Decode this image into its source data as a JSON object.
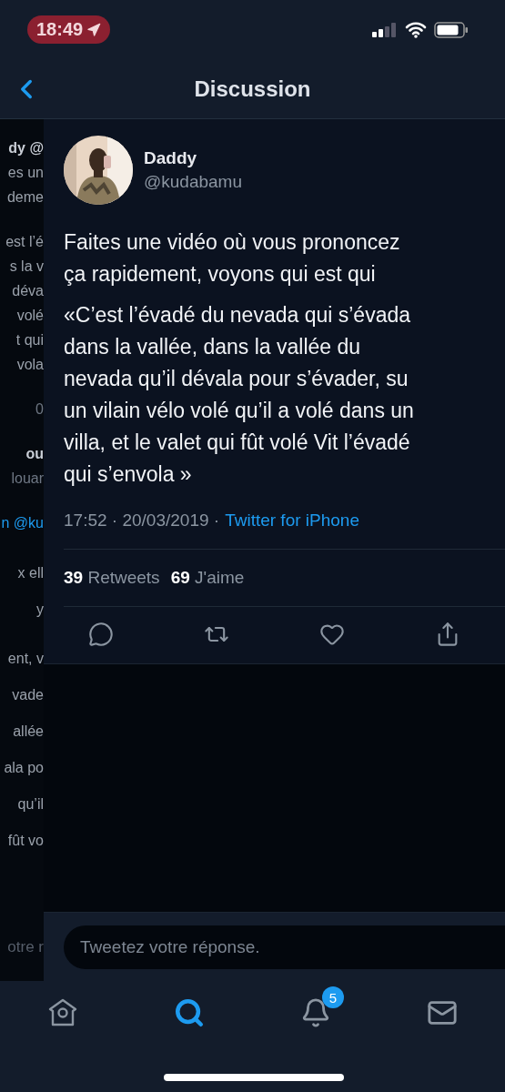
{
  "status_bar": {
    "time": "18:49"
  },
  "header": {
    "title": "Discussion"
  },
  "background_page": {
    "blocks": [
      {
        "kind": "small",
        "lines": [
          {
            "text": "dy @",
            "kind": "bold"
          },
          {
            "text": "es un",
            "kind": "text"
          },
          {
            "text": "deme",
            "kind": "text"
          }
        ]
      },
      {
        "kind": "small",
        "lines": [
          {
            "text": "est l’é",
            "kind": "text"
          },
          {
            "text": "s la v",
            "kind": "text"
          },
          {
            "text": "déva",
            "kind": "text"
          },
          {
            "text": "volé",
            "kind": "text"
          },
          {
            "text": "t qui",
            "kind": "text"
          },
          {
            "text": "vola",
            "kind": "text"
          }
        ]
      },
      {
        "kind": "small",
        "lines": [
          {
            "text": "0",
            "kind": "muted"
          }
        ]
      },
      {
        "kind": "small",
        "lines": [
          {
            "text": "ou",
            "kind": "bold"
          },
          {
            "text": "louar",
            "kind": "muted"
          }
        ]
      },
      {
        "kind": "small",
        "lines": [
          {
            "text": "n @ku",
            "kind": "link"
          }
        ]
      },
      {
        "kind": "large",
        "lines": [
          {
            "text": "x ell",
            "kind": "text"
          },
          {
            "text": "y",
            "kind": "text"
          }
        ]
      },
      {
        "kind": "large",
        "lines": [
          {
            "text": "ent, v",
            "kind": "text"
          },
          {
            "text": "vade",
            "kind": "text"
          },
          {
            "text": "allée",
            "kind": "text"
          },
          {
            "text": "ala po",
            "kind": "text"
          },
          {
            "text": "qu’il",
            "kind": "text"
          },
          {
            "text": "fût vo",
            "kind": "text"
          }
        ]
      }
    ],
    "reply_fragment": "otre r"
  },
  "tweet": {
    "author": {
      "name": "Daddy",
      "handle": "@kudabamu"
    },
    "paragraphs": [
      [
        "Faites une vidéo où vous prononcez",
        "ça rapidement, voyons qui est qui"
      ],
      [
        "«C’est l’évadé du nevada qui s’évada",
        "dans la vallée, dans la vallée du",
        "nevada qu’il dévala pour s’évader, su",
        "un vilain vélo volé qu’il a volé dans un",
        "villa, et le valet qui fût volé Vit l’évadé",
        "qui s’envola »"
      ]
    ],
    "meta": "17:52 · 20/03/2019 ·",
    "source": "Twitter for iPhone",
    "stats": [
      {
        "count": "39",
        "label": "Retweets"
      },
      {
        "count": "69",
        "label": "J'aime"
      }
    ],
    "actions": [
      {
        "kind": "reply"
      },
      {
        "kind": "retweet"
      },
      {
        "kind": "like"
      },
      {
        "kind": "share"
      }
    ]
  },
  "reply_field": {
    "placeholder": "Tweetez votre réponse."
  },
  "tab_bar": [
    {
      "kind": "home",
      "selected": false
    },
    {
      "kind": "search",
      "selected": true
    },
    {
      "kind": "notifications",
      "selected": false,
      "badge": "5"
    },
    {
      "kind": "messages",
      "selected": false
    }
  ]
}
